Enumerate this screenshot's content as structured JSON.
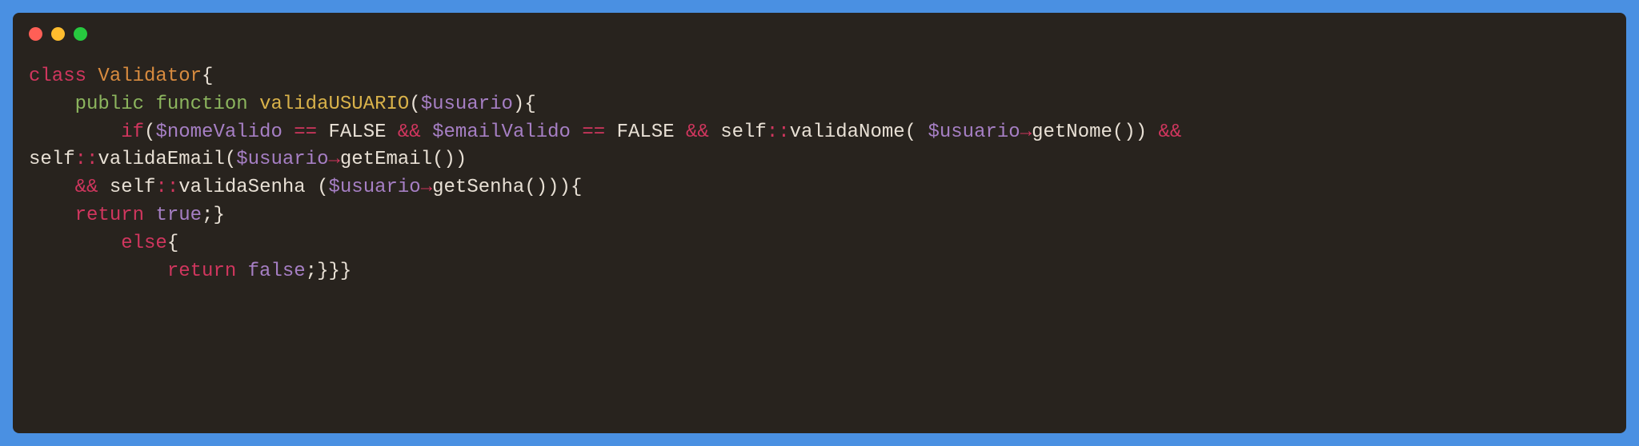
{
  "window": {
    "titleBarButtons": [
      "close",
      "minimize",
      "maximize"
    ]
  },
  "code": {
    "lines": [
      [
        {
          "t": "class ",
          "c": "kw-red"
        },
        {
          "t": "Validator",
          "c": "kw-orange"
        },
        {
          "t": "{",
          "c": "kw-default"
        }
      ],
      [
        {
          "t": "    ",
          "c": "kw-default"
        },
        {
          "t": "public ",
          "c": "kw-green"
        },
        {
          "t": "function ",
          "c": "kw-green"
        },
        {
          "t": "validaUSUARIO",
          "c": "kw-yellow"
        },
        {
          "t": "(",
          "c": "kw-default"
        },
        {
          "t": "$usuario",
          "c": "kw-purple"
        },
        {
          "t": "){",
          "c": "kw-default"
        }
      ],
      [
        {
          "t": "        ",
          "c": "kw-default"
        },
        {
          "t": "if",
          "c": "kw-red"
        },
        {
          "t": "(",
          "c": "kw-default"
        },
        {
          "t": "$nomeValido ",
          "c": "kw-purple"
        },
        {
          "t": "== ",
          "c": "kw-red"
        },
        {
          "t": "FALSE ",
          "c": "kw-default"
        },
        {
          "t": "&& ",
          "c": "kw-red"
        },
        {
          "t": "$emailValido ",
          "c": "kw-purple"
        },
        {
          "t": "== ",
          "c": "kw-red"
        },
        {
          "t": "FALSE ",
          "c": "kw-default"
        },
        {
          "t": "&& ",
          "c": "kw-red"
        },
        {
          "t": "self",
          "c": "kw-default"
        },
        {
          "t": "::",
          "c": "kw-red"
        },
        {
          "t": "validaNome( ",
          "c": "kw-default"
        },
        {
          "t": "$usuario",
          "c": "kw-purple"
        },
        {
          "t": "→",
          "c": "kw-red"
        },
        {
          "t": "getNome()) ",
          "c": "kw-default"
        },
        {
          "t": "&& ",
          "c": "kw-red"
        }
      ],
      [
        {
          "t": "self",
          "c": "kw-default"
        },
        {
          "t": "::",
          "c": "kw-red"
        },
        {
          "t": "validaEmail(",
          "c": "kw-default"
        },
        {
          "t": "$usuario",
          "c": "kw-purple"
        },
        {
          "t": "→",
          "c": "kw-red"
        },
        {
          "t": "getEmail())",
          "c": "kw-default"
        }
      ],
      [
        {
          "t": "    ",
          "c": "kw-default"
        },
        {
          "t": "&& ",
          "c": "kw-red"
        },
        {
          "t": "self",
          "c": "kw-default"
        },
        {
          "t": "::",
          "c": "kw-red"
        },
        {
          "t": "validaSenha (",
          "c": "kw-default"
        },
        {
          "t": "$usuario",
          "c": "kw-purple"
        },
        {
          "t": "→",
          "c": "kw-red"
        },
        {
          "t": "getSenha())){",
          "c": "kw-default"
        }
      ],
      [
        {
          "t": "    ",
          "c": "kw-default"
        },
        {
          "t": "return ",
          "c": "kw-red"
        },
        {
          "t": "true",
          "c": "kw-purple"
        },
        {
          "t": ";}",
          "c": "kw-default"
        }
      ],
      [
        {
          "t": "        ",
          "c": "kw-default"
        },
        {
          "t": "else",
          "c": "kw-red"
        },
        {
          "t": "{",
          "c": "kw-default"
        }
      ],
      [
        {
          "t": "            ",
          "c": "kw-default"
        },
        {
          "t": "return ",
          "c": "kw-red"
        },
        {
          "t": "false",
          "c": "kw-purple"
        },
        {
          "t": ";}}}",
          "c": "kw-default"
        }
      ]
    ]
  }
}
